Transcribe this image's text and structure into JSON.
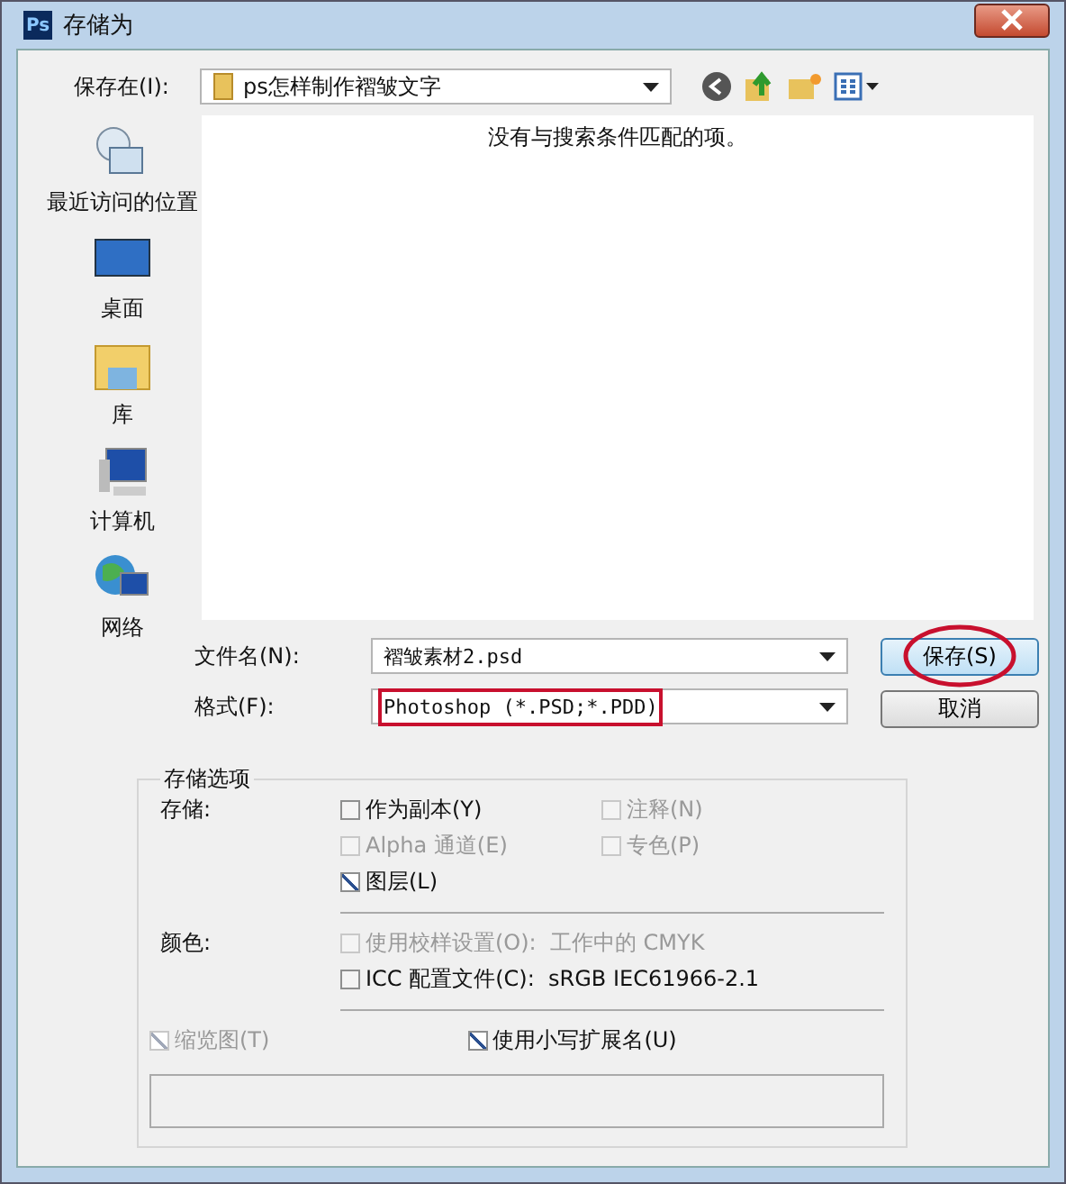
{
  "window": {
    "title": "存储为",
    "app_icon": "Ps"
  },
  "location": {
    "label": "保存在(I):",
    "value": "ps怎样制作褶皱文字"
  },
  "places": [
    {
      "label": "最近访问的位置",
      "kind": "recent"
    },
    {
      "label": "桌面",
      "kind": "desktop"
    },
    {
      "label": "库",
      "kind": "library"
    },
    {
      "label": "计算机",
      "kind": "computer"
    },
    {
      "label": "网络",
      "kind": "network"
    }
  ],
  "file_list": {
    "empty_message": "没有与搜索条件匹配的项。"
  },
  "filename": {
    "label": "文件名(N):",
    "value": "褶皱素材2.psd"
  },
  "format": {
    "label": "格式(F):",
    "value": "Photoshop (*.PSD;*.PDD)",
    "highlighted": true
  },
  "buttons": [
    {
      "label": "保存(S)",
      "highlighted": true
    },
    {
      "label": "取消",
      "highlighted": false
    }
  ],
  "save_options": {
    "title": "存储选项",
    "save_label": "存储:",
    "save_items": [
      {
        "label": "作为副本(Y)",
        "checked": false,
        "disabled": false
      },
      {
        "label": "注释(N)",
        "checked": false,
        "disabled": true
      },
      {
        "label": "Alpha 通道(E)",
        "checked": false,
        "disabled": true
      },
      {
        "label": "专色(P)",
        "checked": false,
        "disabled": true
      },
      {
        "label": "图层(L)",
        "checked": true,
        "disabled": false
      }
    ],
    "color_label": "颜色:",
    "color_items": [
      {
        "label": "使用校样设置(O):  工作中的 CMYK",
        "checked": false,
        "disabled": true
      },
      {
        "label": "ICC 配置文件(C):  sRGB IEC61966-2.1",
        "checked": false,
        "disabled": false
      }
    ],
    "bottom_items": [
      {
        "label": "缩览图(T)",
        "checked": true,
        "disabled": true
      },
      {
        "label": "使用小写扩展名(U)",
        "checked": true,
        "disabled": false
      }
    ]
  }
}
